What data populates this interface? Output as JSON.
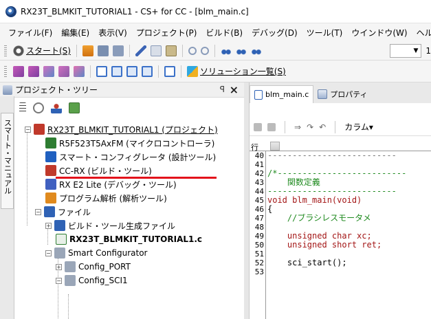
{
  "window": {
    "title": "RX23T_BLMKIT_TUTORIAL1 - CS+ for CC - [blm_main.c]"
  },
  "menu": [
    "ファイル(F)",
    "編集(E)",
    "表示(V)",
    "プロジェクト(P)",
    "ビルド(B)",
    "デバッグ(D)",
    "ツール(T)",
    "ウインドウ(W)",
    "ヘルプ(H"
  ],
  "toolbar1": {
    "start_label": "スタート(S)",
    "combo_value": "1"
  },
  "toolbar2": {
    "solution_label": "ソリューション一覧(S)"
  },
  "tree_panel": {
    "title": "プロジェクト・ツリー",
    "side_tab": "スマート・マニュアル",
    "items": [
      {
        "label": "RX23T_BLMKIT_TUTORIAL1 (プロジェクト)",
        "icon": "project-icon",
        "color": "#c0392b"
      },
      {
        "label": "R5F523T5AxFM (マイクロコントローラ)",
        "icon": "microcontroller-icon",
        "color": "#2e7d32"
      },
      {
        "label": "スマート・コンフィグレータ (設計ツール)",
        "icon": "smart-configurator-icon",
        "color": "#2060c0"
      },
      {
        "label": "CC-RX (ビルド・ツール)",
        "icon": "build-tool-icon",
        "color": "#c0392b"
      },
      {
        "label": "RX E2 Lite (デバッグ・ツール)",
        "icon": "debug-tool-icon",
        "color": "#4060c0"
      },
      {
        "label": "プログラム解析 (解析ツール)",
        "icon": "analysis-tool-icon",
        "color": "#e08a1e"
      },
      {
        "label": "ファイル",
        "icon": "folder-icon",
        "color": "#2f62b5"
      },
      {
        "label": "ビルド・ツール生成ファイル",
        "icon": "generated-files-icon",
        "color": "#2f62b5"
      },
      {
        "label": "RX23T_BLMKIT_TUTORIAL1.c",
        "icon": "c-file-icon",
        "color": "#2e7d32"
      },
      {
        "label": "Smart Configurator",
        "icon": "folder-icon",
        "color": "#9aa6b8"
      },
      {
        "label": "Config_PORT",
        "icon": "folder-icon",
        "color": "#9aa6b8"
      },
      {
        "label": "Config_SCI1",
        "icon": "folder-icon",
        "color": "#9aa6b8"
      }
    ]
  },
  "editor": {
    "tabs": [
      {
        "label": "blm_main.c"
      },
      {
        "label": "プロパティ"
      }
    ],
    "column_label": "カラム▾",
    "gutter_header": "行",
    "line_numbers": [
      "40",
      "41",
      "42",
      "43",
      "44",
      "45",
      "46",
      "47",
      "48",
      "49",
      "50",
      "51",
      "52",
      "53"
    ],
    "lines": [
      {
        "text": "--------------------------",
        "cls": "fold"
      },
      {
        "text": "",
        "cls": ""
      },
      {
        "text": "/*--------------------------",
        "cls": "cm"
      },
      {
        "text": "    関数定義",
        "cls": "cm"
      },
      {
        "text": "--------------------------",
        "cls": "cm"
      },
      {
        "text": "void blm_main(void)",
        "cls": "kw"
      },
      {
        "text": "{",
        "cls": "fn"
      },
      {
        "text": "    //ブラシレスモータメ",
        "cls": "cm"
      },
      {
        "text": "",
        "cls": ""
      },
      {
        "text": "    unsigned char xc;",
        "cls": "kw"
      },
      {
        "text": "    unsigned short ret;",
        "cls": "kw"
      },
      {
        "text": "",
        "cls": ""
      },
      {
        "text": "    sci_start();",
        "cls": "fn"
      },
      {
        "text": "",
        "cls": ""
      }
    ]
  }
}
